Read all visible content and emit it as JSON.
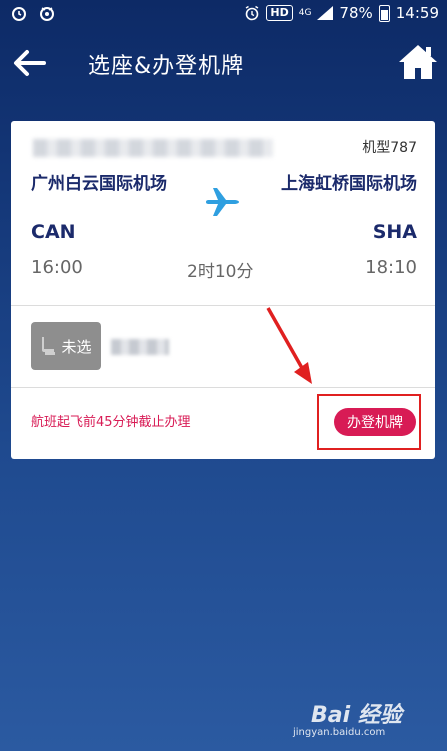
{
  "status_bar": {
    "hd": "HD",
    "network": "4G",
    "battery": "78%",
    "time": "14:59"
  },
  "header": {
    "title": "选座&办登机牌"
  },
  "flight": {
    "aircraft": "机型787",
    "from_city": "广州白云国际机场",
    "to_city": "上海虹桥国际机场",
    "from_code": "CAN",
    "to_code": "SHA",
    "depart_time": "16:00",
    "duration": "2时10分",
    "arrive_time": "18:10"
  },
  "seat": {
    "status": "未选"
  },
  "checkin": {
    "deadline_note": "航班起飞前45分钟截止办理",
    "button_label": "办登机牌"
  },
  "watermark": {
    "main": "Bai 经验",
    "sub": "jingyan.baidu.com"
  },
  "colors": {
    "accent": "#d81b55",
    "primary_text": "#1b2a6b",
    "plane": "#2f9fe0"
  }
}
